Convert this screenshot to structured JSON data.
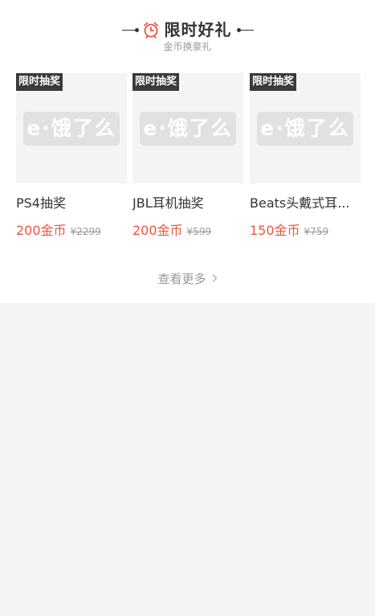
{
  "section": {
    "title": "限时好礼",
    "subtitle": "金币换豪礼"
  },
  "products": [
    {
      "tag": "限时抽奖",
      "placeholder_logo": "e·饿了么",
      "name": "PS4抽奖",
      "price": "200金币",
      "original_price": "¥2299"
    },
    {
      "tag": "限时抽奖",
      "placeholder_logo": "e·饿了么",
      "name": "JBL耳机抽奖",
      "price": "200金币",
      "original_price": "¥599"
    },
    {
      "tag": "限时抽奖",
      "placeholder_logo": "e·饿了么",
      "name": "Beats头戴式耳...",
      "price": "150金币",
      "original_price": "¥759"
    }
  ],
  "more_label": "查看更多",
  "colors": {
    "accent": "#e9573f",
    "title": "#333333",
    "muted": "#999999",
    "background": "#f4f4f4",
    "tag_bg": "#3a3a3a"
  },
  "icons": {
    "title": "alarm-clock-icon",
    "more": "chevron-right-icon"
  }
}
